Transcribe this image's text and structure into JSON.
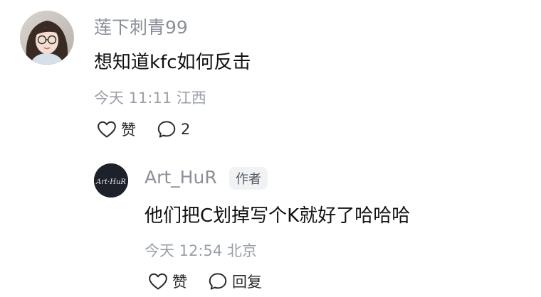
{
  "comment": {
    "username": "莲下刺青99",
    "text": "想知道kfc如何反击",
    "meta": "今天 11:11 江西",
    "like_label": "赞",
    "reply_count": "2"
  },
  "reply": {
    "username": "Art_HuR",
    "author_badge": "作者",
    "avatar_text": "Art·HuR",
    "text": "他们把C划掉写个K就好了哈哈哈",
    "meta": "今天 12:54 北京",
    "like_label": "赞",
    "reply_label": "回复"
  },
  "colors": {
    "username": "#8a8f99",
    "meta": "#9aa0a8",
    "text": "#111111",
    "badge_bg": "#f1f2f4"
  }
}
